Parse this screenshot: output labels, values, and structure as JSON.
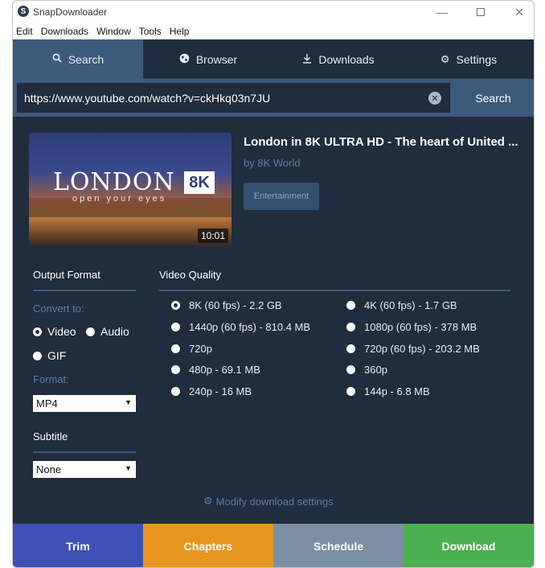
{
  "window": {
    "title": "SnapDownloader",
    "app_icon": "S"
  },
  "menu": [
    "Edit",
    "Downloads",
    "Window",
    "Tools",
    "Help"
  ],
  "tabs": [
    {
      "label": "Search",
      "icon": "search-icon",
      "active": true
    },
    {
      "label": "Browser",
      "icon": "globe-icon",
      "active": false
    },
    {
      "label": "Downloads",
      "icon": "download-icon",
      "active": false
    },
    {
      "label": "Settings",
      "icon": "gear-icon",
      "active": false
    }
  ],
  "urlbar": {
    "value": "https://www.youtube.com/watch?v=ckHkq03n7JU",
    "clear_glyph": "✕",
    "search_label": "Search"
  },
  "video": {
    "title": "London in 8K ULTRA HD - The heart of United ...",
    "channel": "by 8K World",
    "category": "Entertainment",
    "duration": "10:01",
    "thumb_word": "LONDON",
    "thumb_badge": "8K",
    "thumb_tagline": "open your eyes"
  },
  "output_format": {
    "heading": "Output Format",
    "convert_label": "Convert to:",
    "options": [
      {
        "label": "Video",
        "checked": true
      },
      {
        "label": "Audio",
        "checked": false
      },
      {
        "label": "GIF",
        "checked": false
      }
    ],
    "format_label": "Format:",
    "format_value": "MP4",
    "subtitle_heading": "Subtitle",
    "subtitle_value": "None"
  },
  "quality": {
    "heading": "Video Quality",
    "left": [
      {
        "label": "8K (60 fps) - 2.2 GB",
        "checked": true
      },
      {
        "label": "1440p (60 fps) - 810.4 MB",
        "checked": false
      },
      {
        "label": "720p",
        "checked": false
      },
      {
        "label": "480p - 69.1 MB",
        "checked": false
      },
      {
        "label": "240p - 16 MB",
        "checked": false
      }
    ],
    "right": [
      {
        "label": "4K (60 fps) - 1.7 GB",
        "checked": false
      },
      {
        "label": "1080p (60 fps) - 378 MB",
        "checked": false
      },
      {
        "label": "720p (60 fps) - 203.2 MB",
        "checked": false
      },
      {
        "label": "360p",
        "checked": false
      },
      {
        "label": "144p - 6.8 MB",
        "checked": false
      }
    ]
  },
  "modify_label": "Modify download settings",
  "actions": [
    {
      "label": "Trim",
      "color": "#3f51b5"
    },
    {
      "label": "Chapters",
      "color": "#e89520"
    },
    {
      "label": "Schedule",
      "color": "#7b8fa3"
    },
    {
      "label": "Download",
      "color": "#4caf50"
    }
  ],
  "colors": {
    "bg": "#1f2d3d",
    "accent": "#3c5a7a",
    "muted": "#5e7c9b"
  }
}
